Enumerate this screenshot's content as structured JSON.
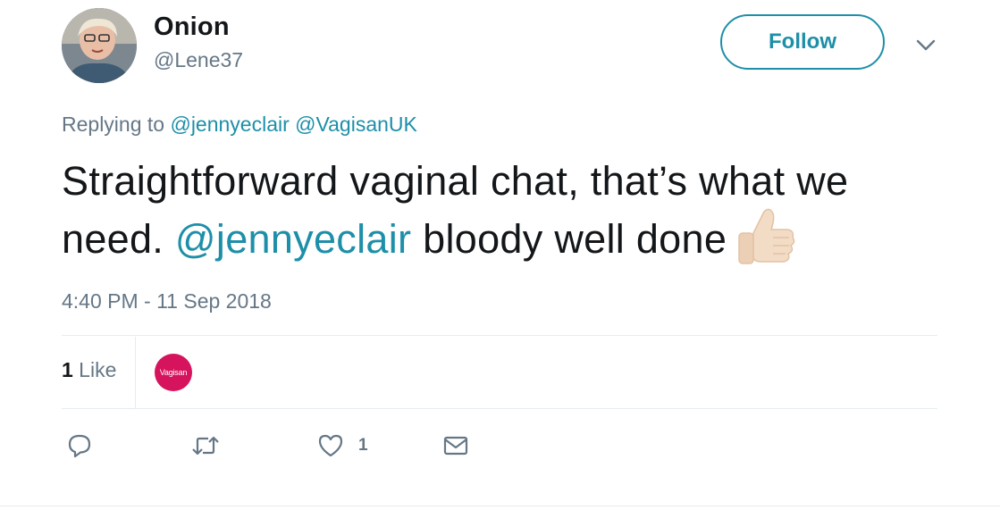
{
  "user": {
    "display_name": "Onion",
    "handle": "@Lene37"
  },
  "header": {
    "follow_label": "Follow"
  },
  "reply": {
    "prefix": "Replying to ",
    "mentions": [
      "@jennyeclair",
      "@VagisanUK"
    ]
  },
  "tweet": {
    "text_part1": "Straightforward vaginal chat, that’s what we need. ",
    "mention": "@jennyeclair",
    "text_part2": " bloody well done",
    "emoji": "thumbs-up-light-skin-tone"
  },
  "timestamp": "4:40 PM - 11 Sep 2018",
  "stats": {
    "likes_count": "1",
    "likes_label": " Like",
    "liker_avatar_text": "Vagisan"
  },
  "actions": {
    "like_count": "1"
  },
  "colors": {
    "accent": "#1d8fa8",
    "text": "#14171a",
    "muted": "#657786",
    "divider": "#e6ecf0",
    "liker_avatar_bg": "#d6145e"
  }
}
